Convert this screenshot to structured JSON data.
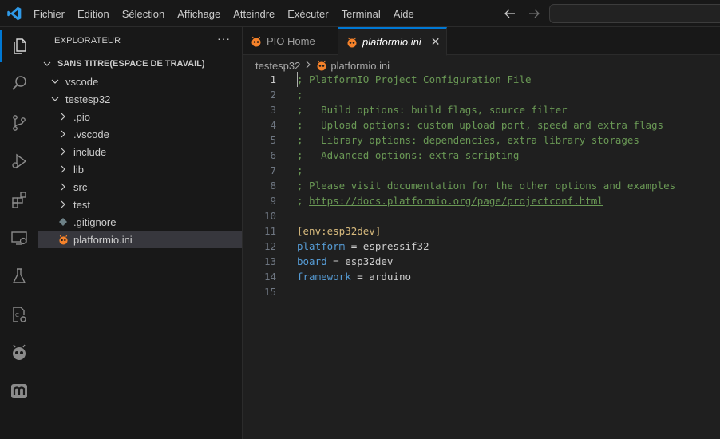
{
  "menu": [
    "Fichier",
    "Edition",
    "Sélection",
    "Affichage",
    "Atteindre",
    "Exécuter",
    "Terminal",
    "Aide"
  ],
  "colors": {
    "accent": "#0078d4",
    "comment": "#6a9955",
    "section": "#d7ba7d",
    "key": "#569cd6",
    "platformio": "#f5822a"
  },
  "activitybar": [
    "files-icon",
    "search-icon",
    "source-control-icon",
    "run-debug-icon",
    "extensions-icon",
    "remote-explorer-icon",
    "testing-icon",
    "cmake-icon",
    "platformio-icon",
    "m-icon"
  ],
  "sidebar": {
    "title": "EXPLORATEUR",
    "more": "···",
    "workspace": "SANS TITRE(ESPACE DE TRAVAIL)",
    "items": [
      {
        "label": "vscode",
        "type": "folder"
      },
      {
        "label": "testesp32",
        "type": "folder-open"
      },
      {
        "label": ".pio",
        "type": "folder"
      },
      {
        "label": ".vscode",
        "type": "folder"
      },
      {
        "label": "include",
        "type": "folder"
      },
      {
        "label": "lib",
        "type": "folder"
      },
      {
        "label": "src",
        "type": "folder"
      },
      {
        "label": "test",
        "type": "folder"
      },
      {
        "label": ".gitignore",
        "type": "file-git"
      },
      {
        "label": "platformio.ini",
        "type": "file-pio"
      }
    ]
  },
  "tabs": [
    {
      "label": "PIO Home",
      "active": false
    },
    {
      "label": "platformio.ini",
      "active": true,
      "close": "✕"
    }
  ],
  "breadcrumb": [
    "testesp32",
    "platformio.ini"
  ],
  "editor": {
    "lines": [
      {
        "n": "1",
        "parts": [
          {
            "t": "; PlatformIO Project Configuration File",
            "c": "cmt"
          }
        ]
      },
      {
        "n": "2",
        "parts": [
          {
            "t": ";",
            "c": "cmt"
          }
        ]
      },
      {
        "n": "3",
        "parts": [
          {
            "t": ";   Build options: build flags, source filter",
            "c": "cmt"
          }
        ]
      },
      {
        "n": "4",
        "parts": [
          {
            "t": ";   Upload options: custom upload port, speed and extra flags",
            "c": "cmt"
          }
        ]
      },
      {
        "n": "5",
        "parts": [
          {
            "t": ";   Library options: dependencies, extra library storages",
            "c": "cmt"
          }
        ]
      },
      {
        "n": "6",
        "parts": [
          {
            "t": ";   Advanced options: extra scripting",
            "c": "cmt"
          }
        ]
      },
      {
        "n": "7",
        "parts": [
          {
            "t": ";",
            "c": "cmt"
          }
        ]
      },
      {
        "n": "8",
        "parts": [
          {
            "t": "; Please visit documentation for the other options and examples",
            "c": "cmt"
          }
        ]
      },
      {
        "n": "9",
        "parts": [
          {
            "t": "; ",
            "c": "cmt"
          },
          {
            "t": "https://docs.platformio.org/page/projectconf.html",
            "c": "cmt link"
          }
        ]
      },
      {
        "n": "10",
        "parts": []
      },
      {
        "n": "11",
        "parts": [
          {
            "t": "[env:esp32dev]",
            "c": "sect"
          }
        ]
      },
      {
        "n": "12",
        "parts": [
          {
            "t": "platform",
            "c": "key"
          },
          {
            "t": " = espressif32",
            "c": "val"
          }
        ]
      },
      {
        "n": "13",
        "parts": [
          {
            "t": "board",
            "c": "key"
          },
          {
            "t": " = esp32dev",
            "c": "val"
          }
        ]
      },
      {
        "n": "14",
        "parts": [
          {
            "t": "framework",
            "c": "key"
          },
          {
            "t": " = arduino",
            "c": "val"
          }
        ]
      },
      {
        "n": "15",
        "parts": []
      }
    ],
    "current_line": "1"
  }
}
